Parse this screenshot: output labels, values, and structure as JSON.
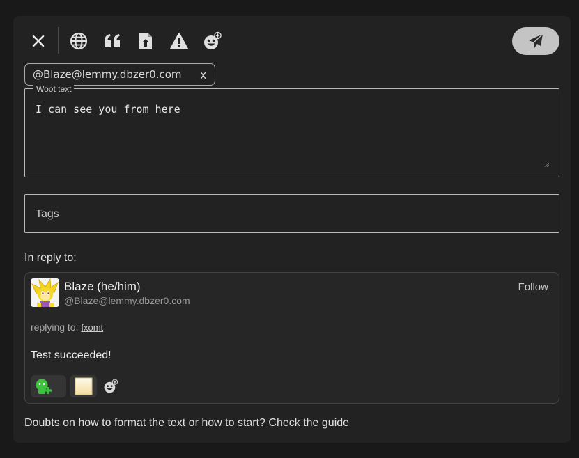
{
  "toolbar": {
    "buttons": [
      {
        "name": "close-icon",
        "label": "Close"
      },
      {
        "name": "globe-icon",
        "label": "Visibility"
      },
      {
        "name": "quote-icon",
        "label": "Quote"
      },
      {
        "name": "file-upload-icon",
        "label": "Upload file"
      },
      {
        "name": "warning-icon",
        "label": "Content warning"
      },
      {
        "name": "emoji-add-icon",
        "label": "Add emoji"
      }
    ],
    "send_icon": "send-icon"
  },
  "mention_chip": {
    "text": "@Blaze@lemmy.dbzer0.com",
    "remove_label": "x"
  },
  "woot": {
    "legend": "Woot text",
    "value": "I can see you from here"
  },
  "tags": {
    "placeholder": "Tags"
  },
  "reply": {
    "label": "In reply to:",
    "author_name": "Blaze (he/him)",
    "author_handle": "@Blaze@lemmy.dbzer0.com",
    "follow_label": "Follow",
    "replying_to_prefix": "replying to:",
    "replying_to_user": "fxomt",
    "body": "Test succeeded!"
  },
  "footer": {
    "text": "Doubts on how to format the text or how to start? Check ",
    "link": "the guide"
  },
  "colors": {
    "panel_bg": "#222222",
    "page_bg": "#191919",
    "send_bg": "#c4c4c4",
    "accent_green": "#3cc23c"
  }
}
